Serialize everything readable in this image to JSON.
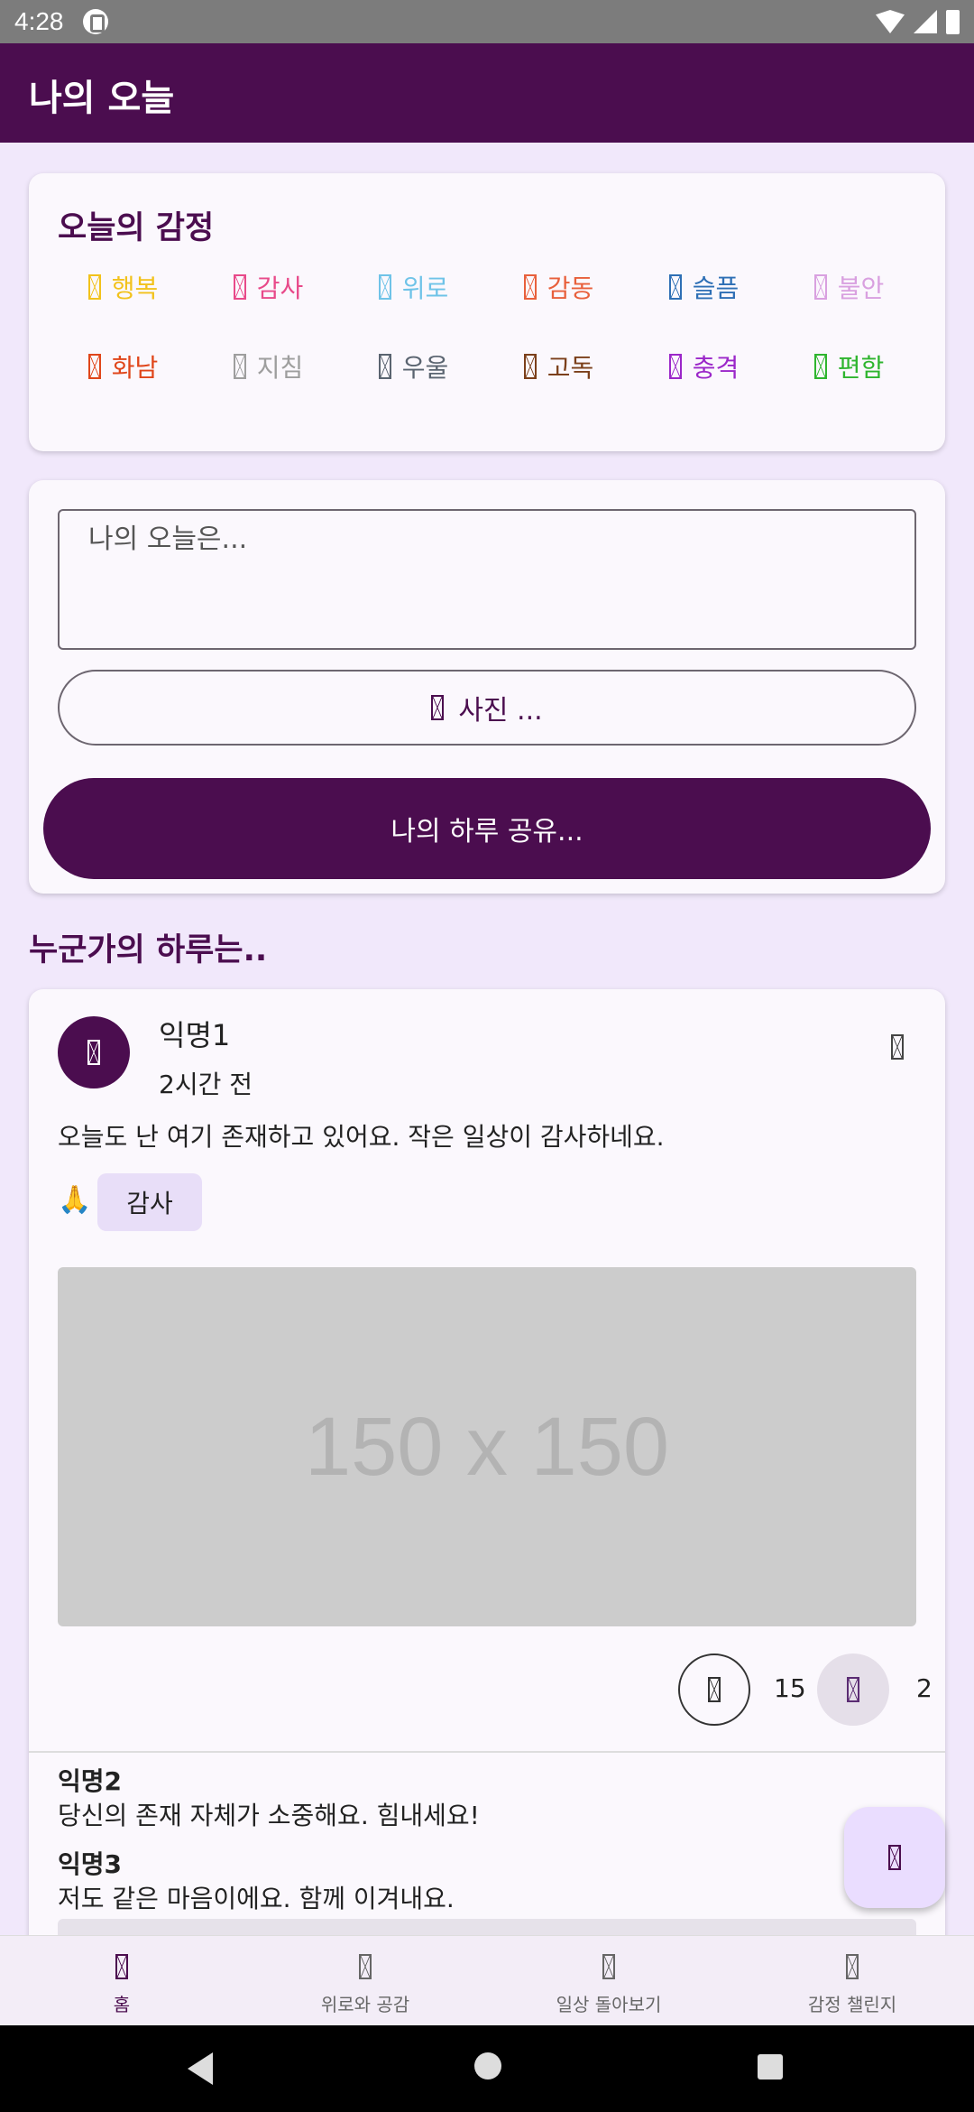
{
  "status_bar": {
    "time": "4:28"
  },
  "app_bar": {
    "title": "나의 오늘"
  },
  "emotions": {
    "title": "오늘의 감정",
    "items": [
      {
        "label": "행복",
        "color": "#f2c21b",
        "icon": "happy-icon"
      },
      {
        "label": "감사",
        "color": "#e84a8a",
        "icon": "thanks-icon"
      },
      {
        "label": "위로",
        "color": "#6fc3e8",
        "icon": "comfort-icon"
      },
      {
        "label": "감동",
        "color": "#e8603c",
        "icon": "moved-icon"
      },
      {
        "label": "슬픔",
        "color": "#2e6fb5",
        "icon": "sad-icon"
      },
      {
        "label": "불안",
        "color": "#d9a0e0",
        "icon": "anxious-icon"
      },
      {
        "label": "화남",
        "color": "#e0461a",
        "icon": "angry-icon"
      },
      {
        "label": "지침",
        "color": "#9e9e9e",
        "icon": "tired-icon"
      },
      {
        "label": "우울",
        "color": "#5a6470",
        "icon": "depressed-icon"
      },
      {
        "label": "고독",
        "color": "#7b3f1a",
        "icon": "lonely-icon"
      },
      {
        "label": "충격",
        "color": "#9b27c9",
        "icon": "shocked-icon"
      },
      {
        "label": "편함",
        "color": "#2eb52e",
        "icon": "relaxed-icon"
      }
    ]
  },
  "compose": {
    "placeholder": "나의 오늘은...",
    "photo_label": "사진 ...",
    "share_label": "나의 하루 공유..."
  },
  "feed": {
    "section_title": "누군가의 하루는..",
    "post": {
      "author": "익명1",
      "time": "2시간 전",
      "body": "오늘도 난 여기 존재하고 있어요. 작은 일상이 감사하네요.",
      "emotion_emoji": "🙏",
      "emotion_tag": "감사",
      "image_placeholder": "150 x 150",
      "comfort_count": "15",
      "empathy_count": "2",
      "comments": [
        {
          "author": "익명2",
          "text": "당신의 존재 자체가 소중해요. 힘내세요!"
        },
        {
          "author": "익명3",
          "text": "저도 같은 마음이에요. 함께 이겨내요."
        }
      ]
    }
  },
  "bottom_nav": {
    "items": [
      {
        "label": "홈",
        "active": true
      },
      {
        "label": "위로와 공감",
        "active": false
      },
      {
        "label": "일상 돌아보기",
        "active": false
      },
      {
        "label": "감정 챌린지",
        "active": false
      }
    ]
  },
  "colors": {
    "primary": "#4b0d4f",
    "background": "#f1e8fb",
    "fab": "#eaddff"
  }
}
